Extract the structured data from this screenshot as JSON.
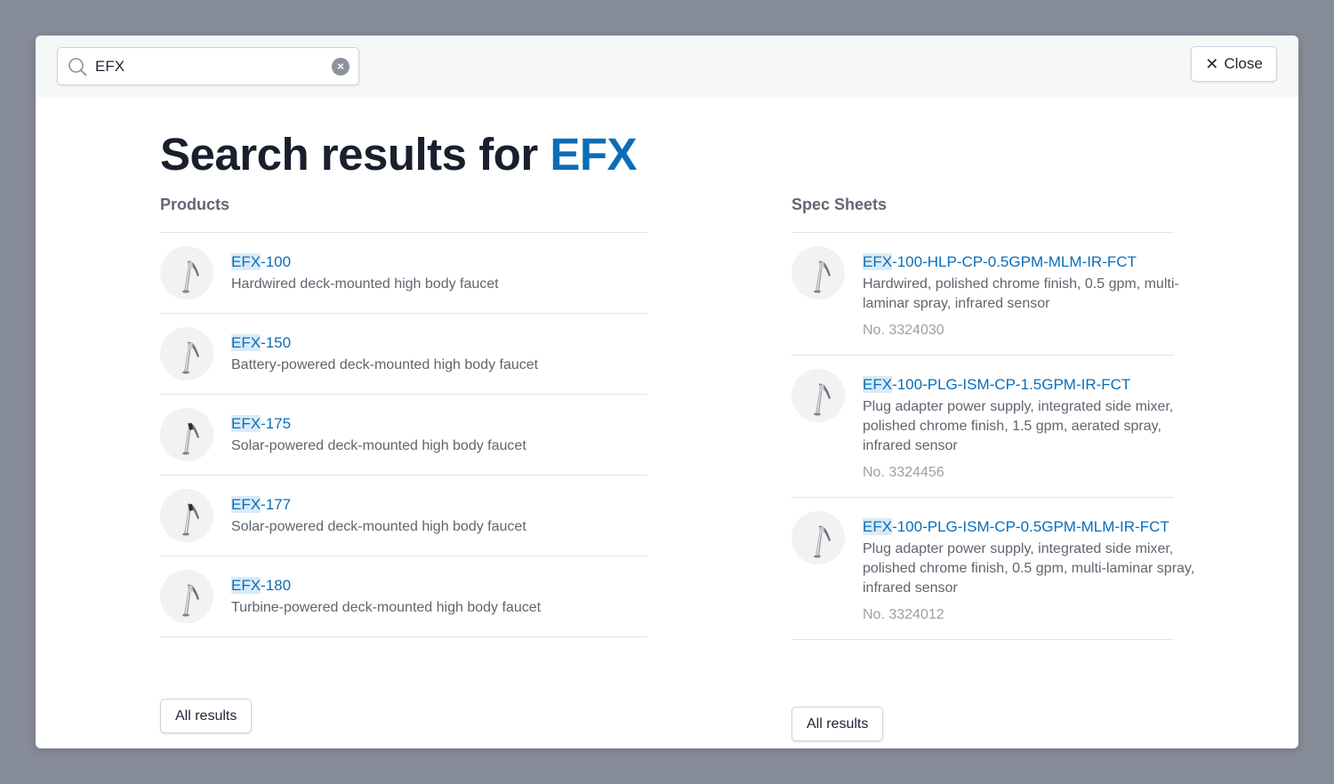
{
  "search": {
    "value": "EFX",
    "placeholder": ""
  },
  "close_label": "Close",
  "heading": {
    "prefix": "Search results for ",
    "query": "EFX"
  },
  "colors": {
    "accent": "#0b6db7",
    "highlight": "#d9ebf8",
    "backdrop": "#878c99"
  },
  "products": {
    "title": "Products",
    "items": [
      {
        "hl": "EFX",
        "rest": "-100",
        "desc": "Hardwired deck-mounted high body faucet",
        "icon": "faucet-chrome"
      },
      {
        "hl": "EFX",
        "rest": "-150",
        "desc": "Battery-powered deck-mounted high body faucet",
        "icon": "faucet-chrome"
      },
      {
        "hl": "EFX",
        "rest": "-175",
        "desc": "Solar-powered deck-mounted high body faucet",
        "icon": "faucet-solar"
      },
      {
        "hl": "EFX",
        "rest": "-177",
        "desc": "Solar-powered deck-mounted high body faucet",
        "icon": "faucet-solar"
      },
      {
        "hl": "EFX",
        "rest": "-180",
        "desc": "Turbine-powered deck-mounted high body faucet",
        "icon": "faucet-chrome"
      }
    ],
    "all_label": "All results"
  },
  "specs": {
    "title": "Spec Sheets",
    "items": [
      {
        "hl": "EFX",
        "rest": "-100-HLP-CP-0.5GPM-MLM-IR-FCT",
        "desc": "Hardwired, polished chrome finish, 0.5 gpm, multi-laminar spray, infrared sensor",
        "no": "No. 3324030"
      },
      {
        "hl": "EFX",
        "rest": "-100-PLG-ISM-CP-1.5GPM-IR-FCT",
        "desc": "Plug adapter power supply, integrated side mixer, polished chrome finish, 1.5 gpm, aerated spray, infrared sensor",
        "no": "No. 3324456"
      },
      {
        "hl": "EFX",
        "rest": "-100-PLG-ISM-CP-0.5GPM-MLM-IR-FCT",
        "desc": "Plug adapter power supply, integrated side mixer, polished chrome finish, 0.5 gpm, multi-laminar spray, infrared sensor",
        "no": "No. 3324012"
      }
    ],
    "all_label": "All results"
  }
}
